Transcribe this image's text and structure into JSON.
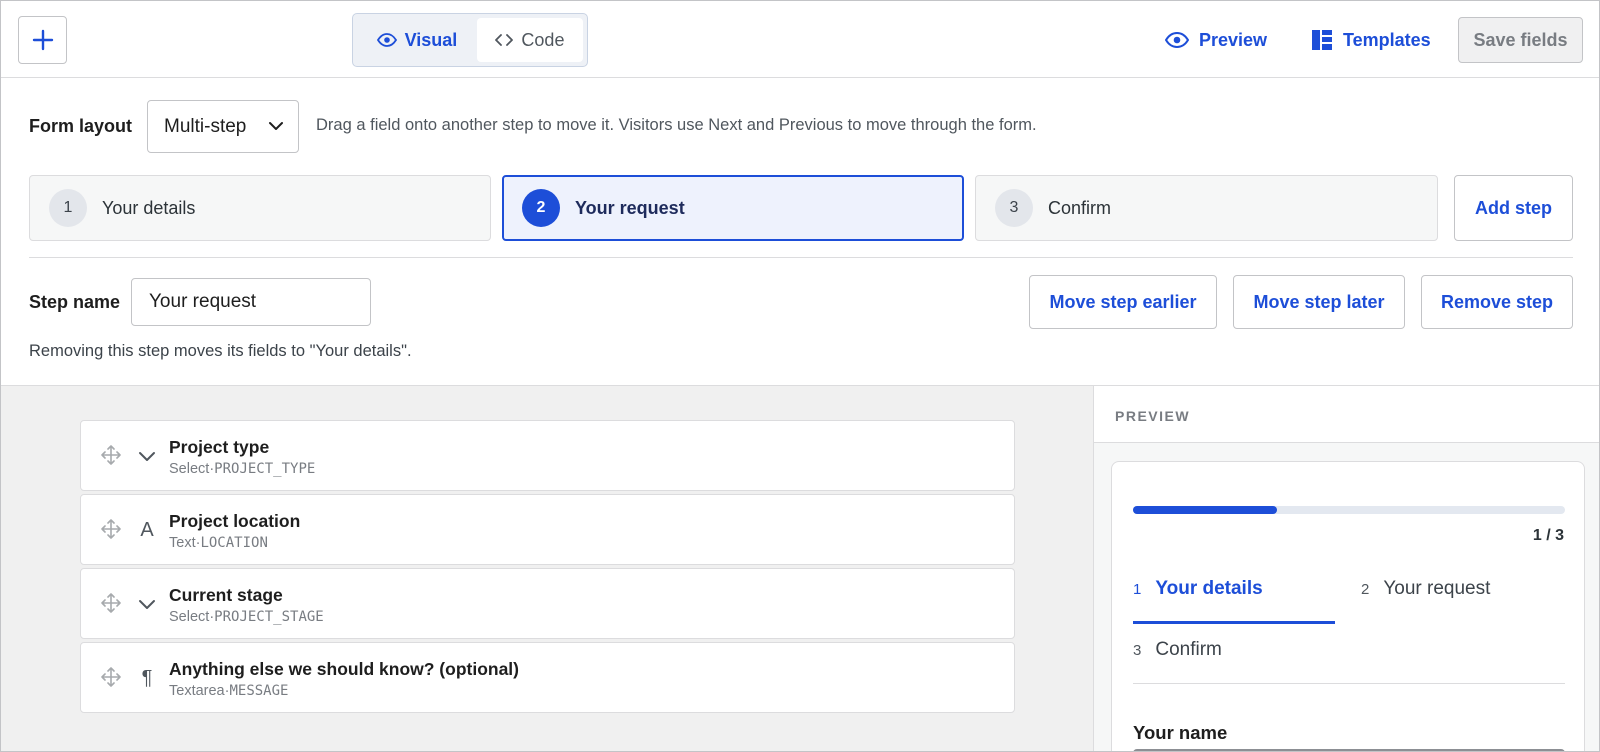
{
  "toolbar": {
    "add_button_icon": "plus-icon",
    "mode_switch": {
      "visual_label": "Visual",
      "code_label": "Code",
      "active": "Visual"
    },
    "preview_label": "Preview",
    "templates_label": "Templates",
    "save_label": "Save fields"
  },
  "form_layout": {
    "label": "Form layout",
    "selected": "Multi-step",
    "help": "Drag a field onto another step to move it. Visitors use Next and Previous to move through the form."
  },
  "steps": [
    {
      "number": "1",
      "label": "Your details"
    },
    {
      "number": "2",
      "label": "Your request"
    },
    {
      "number": "3",
      "label": "Confirm"
    }
  ],
  "active_step": 2,
  "add_step_label": "Add step",
  "step_editor": {
    "name_label": "Step name",
    "name_value": "Your request",
    "move_earlier_label": "Move step earlier",
    "move_later_label": "Move step later",
    "remove_label": "Remove step",
    "remove_help": "Removing this step moves its fields to \"Your details\"."
  },
  "fields": [
    {
      "name": "Project type",
      "type": "Select",
      "key": "PROJECT_TYPE",
      "icon": "chevron-down-icon"
    },
    {
      "name": "Project location",
      "type": "Text",
      "key": "LOCATION",
      "icon": "text-icon"
    },
    {
      "name": "Current stage",
      "type": "Select",
      "key": "PROJECT_STAGE",
      "icon": "chevron-down-icon"
    },
    {
      "name": "Anything else we should know? (optional)",
      "type": "Textarea",
      "key": "MESSAGE",
      "icon": "paragraph-icon"
    }
  ],
  "field_meta_separator": " · ",
  "preview": {
    "header": "PREVIEW",
    "progress": {
      "current": 1,
      "total": 3,
      "fraction": 0.333,
      "text": "1 / 3"
    },
    "tabs": [
      {
        "number": "1",
        "label": "Your details"
      },
      {
        "number": "2",
        "label": "Your request"
      },
      {
        "number": "3",
        "label": "Confirm"
      }
    ],
    "first_field_label": "Your name"
  },
  "colors": {
    "accent": "#1d4ed8",
    "active_step_bg": "#eef2fd",
    "canvas_bg": "#f0f0f0",
    "border": "#dcdcde"
  }
}
